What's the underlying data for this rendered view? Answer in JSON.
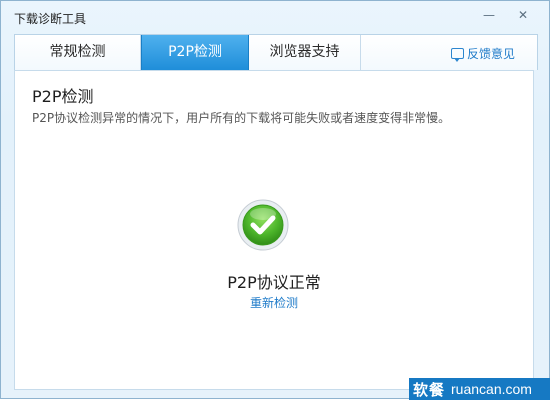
{
  "window": {
    "title": "下载诊断工具",
    "min_icon": "minimize-icon",
    "close_icon": "close-icon"
  },
  "tabs": [
    {
      "label": "常规检测"
    },
    {
      "label": "P2P检测"
    },
    {
      "label": "浏览器支持"
    }
  ],
  "active_tab": "P2P检测",
  "feedback": {
    "label": "反馈意见",
    "icon": "feedback-icon"
  },
  "section": {
    "title": "P2P检测",
    "description": "P2P协议检测异常的情况下，用户所有的下载将可能失败或者速度变得非常慢。"
  },
  "result": {
    "icon": "check-icon",
    "status": "P2P协议正常",
    "recheck_label": "重新检测"
  },
  "watermark": {
    "cn": "软餐",
    "en": "ruancan.com"
  },
  "colors": {
    "accent": "#2592dd",
    "link": "#1f7bc9",
    "success": "#4cb52a"
  }
}
